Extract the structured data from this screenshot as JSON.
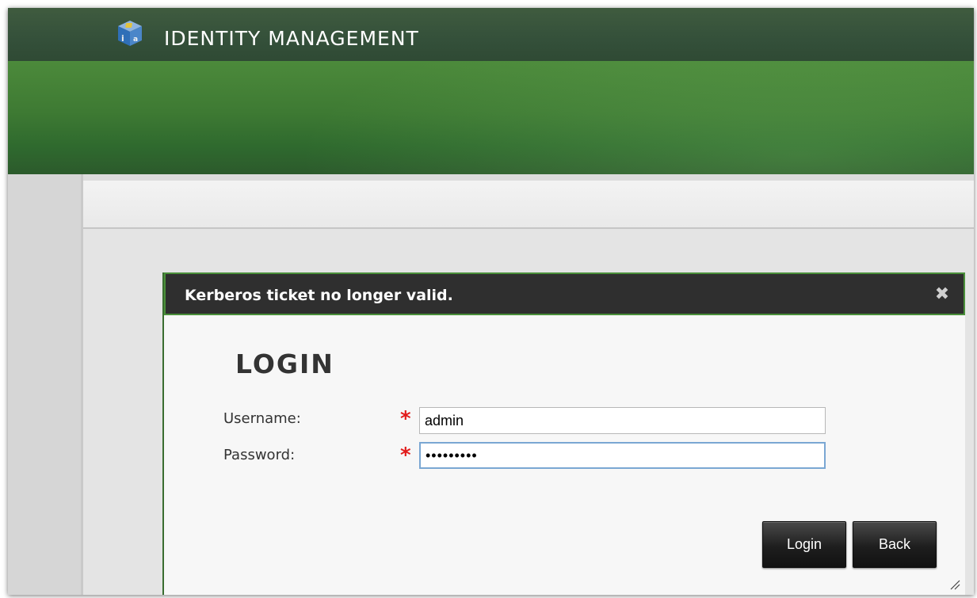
{
  "app": {
    "title": "IDENTITY MANAGEMENT",
    "logo_icon": "ipa-cube-logo-icon"
  },
  "dialog": {
    "title": "Kerberos ticket no longer valid.",
    "close_icon": "close-icon",
    "heading": "LOGIN",
    "fields": {
      "username": {
        "label": "Username:",
        "required_mark": "*",
        "value": "admin"
      },
      "password": {
        "label": "Password:",
        "required_mark": "*",
        "value": "•••••••••"
      }
    },
    "buttons": {
      "login": "Login",
      "back": "Back"
    },
    "resize_icon": "resize-grip-icon"
  },
  "colors": {
    "header_bar": "#3a563c",
    "banner_green": "#3e7a33",
    "dialog_titlebar": "#2f2f2f",
    "dialog_border": "#4a8f3a",
    "required": "#e21b1b",
    "button": "#1e1e1e"
  }
}
